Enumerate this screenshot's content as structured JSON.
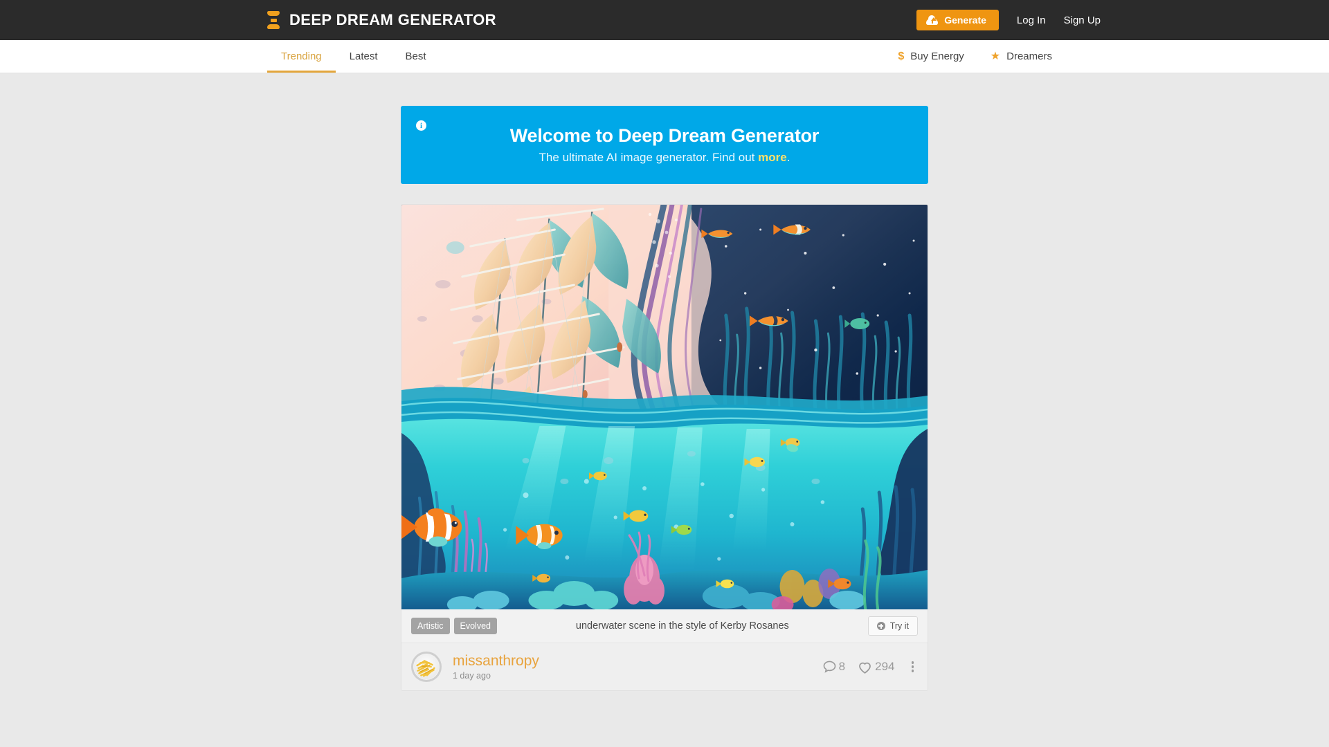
{
  "topbar": {
    "logo_icon": "hourglass-bars-icon",
    "brand": "DEEP DREAM GENERATOR",
    "generate_label": "Generate",
    "generate_icon": "cloud-upload-icon",
    "login_label": "Log In",
    "signup_label": "Sign Up",
    "accent": "#ef9511",
    "background": "#2b2b2b"
  },
  "subnav": {
    "tabs": [
      {
        "label": "Trending",
        "active": true
      },
      {
        "label": "Latest",
        "active": false
      },
      {
        "label": "Best",
        "active": false
      }
    ],
    "links": [
      {
        "label": "Buy Energy",
        "icon": "dollar-icon"
      },
      {
        "label": "Dreamers",
        "icon": "star-icon"
      }
    ],
    "active_color": "#d9a441"
  },
  "banner": {
    "icon": "info-icon",
    "title": "Welcome to Deep Dream Generator",
    "subtitle_before": "The ultimate AI image generator. Find out ",
    "subtitle_link": "more",
    "subtitle_after": ".",
    "background": "#00a8e8",
    "link_color": "#ffe06a"
  },
  "dream": {
    "image_alt": "underwater scene with a sailing ship above the waterline and coral reef below",
    "tags": [
      "Artistic",
      "Evolved"
    ],
    "caption": "underwater scene in the style of Kerby Rosanes",
    "try_label": "Try it",
    "try_icon": "plus-circle-icon",
    "author": "missanthropy",
    "author_color": "#e8a33d",
    "time": "1 day ago",
    "avatar_alt": "plate of french fries",
    "comments_icon": "comment-bubble-icon",
    "comments": "8",
    "likes_icon": "heart-icon",
    "likes": "294",
    "menu_icon": "kebab-menu-icon"
  }
}
